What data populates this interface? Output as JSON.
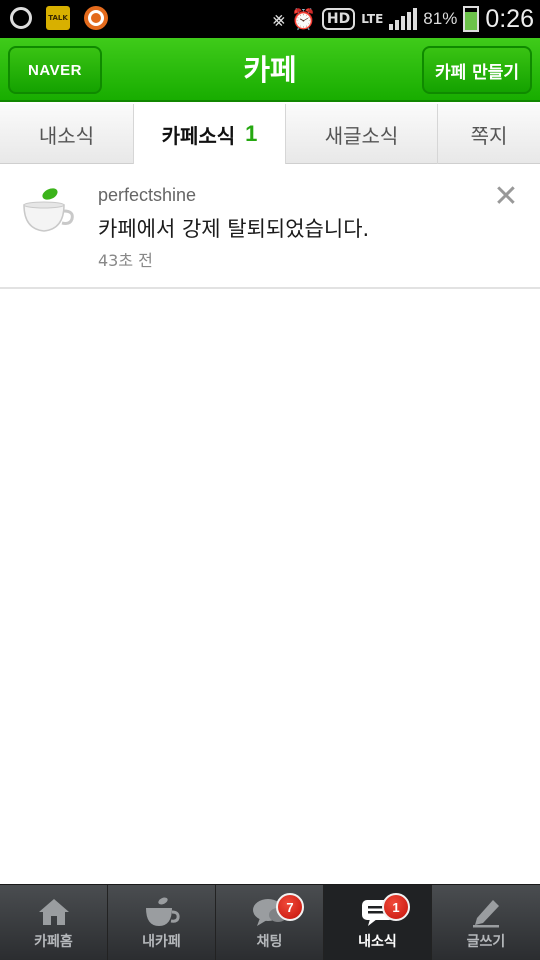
{
  "status_bar": {
    "battery_percent": "81%",
    "battery_level": 0.81,
    "time": "0:26",
    "network": "LTE",
    "hd_label": "HD",
    "kakao_label": "TALK"
  },
  "header": {
    "left_button": "NAVER",
    "title": "카페",
    "right_button": "카페 만들기"
  },
  "tabs": [
    {
      "label": "내소식",
      "badge": ""
    },
    {
      "label": "카페소식",
      "badge": "1"
    },
    {
      "label": "새글소식",
      "badge": ""
    },
    {
      "label": "쪽지",
      "badge": ""
    }
  ],
  "notification": {
    "user": "perfectshine",
    "message": "카페에서 강제 탈퇴되었습니다.",
    "time": "43초 전"
  },
  "bottom_nav": [
    {
      "label": "카페홈",
      "icon": "home-icon",
      "badge": ""
    },
    {
      "label": "내카페",
      "icon": "cup-icon",
      "badge": ""
    },
    {
      "label": "채팅",
      "icon": "chat-icon",
      "badge": "7"
    },
    {
      "label": "내소식",
      "icon": "message-icon",
      "badge": "1"
    },
    {
      "label": "글쓰기",
      "icon": "pen-icon",
      "badge": ""
    }
  ],
  "colors": {
    "brand_green": "#1fb500",
    "badge_red": "#d8261a",
    "tab_badge_green": "#26a811"
  }
}
